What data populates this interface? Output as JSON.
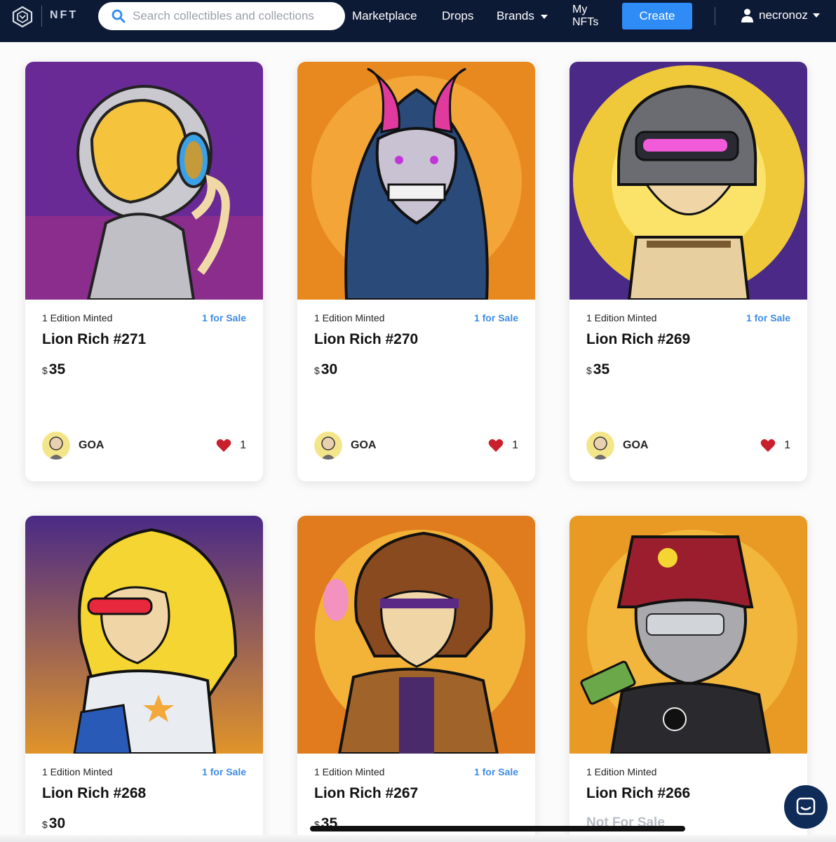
{
  "navbar": {
    "brand": "NFT",
    "search_placeholder": "Search collectibles and collections",
    "links": {
      "marketplace": "Marketplace",
      "drops": "Drops",
      "brands": "Brands",
      "my_nfts_line1": "My",
      "my_nfts_line2": "NFTs"
    },
    "create_label": "Create",
    "username": "necronoz"
  },
  "colors": {
    "navbar_bg": "#0d1a36",
    "accent_blue": "#2f8cf6",
    "for_sale_blue": "#3d8ce4",
    "heart_red": "#c8202c"
  },
  "cards": [
    {
      "edition": "1 Edition Minted",
      "sale": "1 for Sale",
      "title": "Lion Rich #271",
      "currency": "$",
      "price": "35",
      "creator": "GOA",
      "likes": "1",
      "bg": "#6a2a96"
    },
    {
      "edition": "1 Edition Minted",
      "sale": "1 for Sale",
      "title": "Lion Rich #270",
      "currency": "$",
      "price": "30",
      "creator": "GOA",
      "likes": "1",
      "bg": "#e8891f"
    },
    {
      "edition": "1 Edition Minted",
      "sale": "1 for Sale",
      "title": "Lion Rich #269",
      "currency": "$",
      "price": "35",
      "creator": "GOA",
      "likes": "1",
      "bg": "#f0c93a"
    },
    {
      "edition": "1 Edition Minted",
      "sale": "1 for Sale",
      "title": "Lion Rich #268",
      "currency": "$",
      "price": "30",
      "bg": "#b0602c"
    },
    {
      "edition": "1 Edition Minted",
      "sale": "1 for Sale",
      "title": "Lion Rich #267",
      "currency": "$",
      "price": "35",
      "bg": "#e07b1e"
    },
    {
      "edition": "1 Edition Minted",
      "sale": "",
      "title": "Lion Rich #266",
      "price_text": "Not For Sale",
      "bg": "#e89a25"
    }
  ]
}
